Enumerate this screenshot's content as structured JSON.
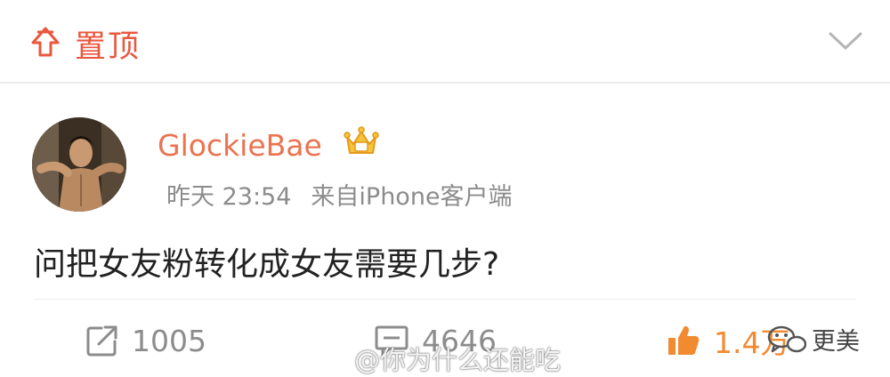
{
  "pinned": {
    "label": "置顶"
  },
  "post": {
    "author": "GlockieBae",
    "time": "昨天 23:54",
    "source": "来自iPhone客户端",
    "text": "问把女友粉转化成女友需要几步?"
  },
  "actions": {
    "repost_count": "1005",
    "comment_count": "4646",
    "like_count": "1.4万"
  },
  "overlay": {
    "watermark": "@你为什么还能吃",
    "wechat_account": "更美"
  },
  "icons": [
    "pin-icon",
    "chevron-down-icon",
    "vip-crown-icon",
    "repost-icon",
    "comment-icon",
    "like-icon",
    "wechat-icon"
  ],
  "colors": {
    "accent": "#eb7350",
    "like": "#f28a30",
    "muted": "#8c8c8c",
    "text": "#222222"
  }
}
